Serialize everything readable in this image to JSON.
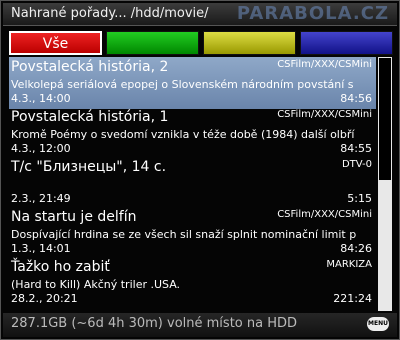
{
  "header": {
    "title": "Nahrané pořady...  /hdd/movie/",
    "watermark": "PARABOLA.CZ"
  },
  "color_buttons": {
    "red": "Vše",
    "green": "",
    "yellow": "",
    "blue": ""
  },
  "recordings": [
    {
      "name": "Povstalecká história, 2",
      "channel": "CSFilm/XXX/CSMini",
      "description": "Velkolepá seriálová epopej o Slovenském národním povstání s",
      "date": "4.3., 14:00",
      "duration": "84:56",
      "selected": true
    },
    {
      "name": "Povstalecká história, 1",
      "channel": "CSFilm/XXX/CSMini",
      "description": "Kromě Poémy o svedomí vznikla v téže době (1984) další olbří",
      "date": "4.3., 12:00",
      "duration": "84:55"
    },
    {
      "name": "T/c \"Близнецы\", 14 c.",
      "channel": "DTV-0",
      "description": "",
      "date": "2.3., 21:49",
      "duration": "5:15"
    },
    {
      "name": "Na startu je delfín",
      "channel": "CSFilm/XXX/CSMini",
      "description": "Dospívající hrdina se ze všech sil snaží splnit nominační limit p",
      "date": "1.3., 14:01",
      "duration": "84:26"
    },
    {
      "name": "Ťažko ho zabiť",
      "channel": "MARKIZA",
      "description": "(Hard to Kill) Akčný triler .USA.",
      "date": "28.2., 20:21",
      "duration": "221:24"
    }
  ],
  "footer": {
    "status": "287.1GB (~6d 4h 30m) volné místo na HDD",
    "menu_label": "MENU"
  }
}
